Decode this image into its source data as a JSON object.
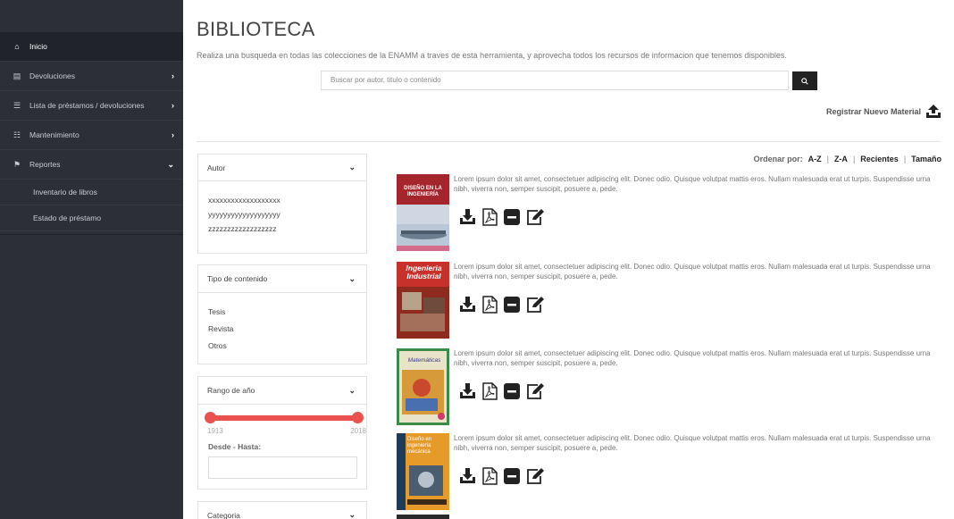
{
  "sidebar": {
    "items": [
      {
        "label": "Inicio",
        "icon": "home-icon",
        "glyph": "⌂",
        "chevron": "",
        "active": true
      },
      {
        "label": "Devoluciones",
        "icon": "file-icon",
        "glyph": "▤",
        "chevron": "›"
      },
      {
        "label": "Lista de préstamos / devoluciones",
        "icon": "list-icon",
        "glyph": "☰",
        "chevron": "›"
      },
      {
        "label": "Mantenimiento",
        "icon": "grid-icon",
        "glyph": "☷",
        "chevron": "›"
      },
      {
        "label": "Reportes",
        "icon": "report-icon",
        "glyph": "⚑",
        "chevron": "⌄"
      }
    ],
    "subitems": [
      "Inventario de libros",
      "Estado de préstamo"
    ]
  },
  "main": {
    "title": "BIBLIOTECA",
    "subtitle": "Realiza una busqueda en todas las colecciones de la ENAMM a traves de esta herramienta, y aprovecha todos los recursos de informacion que tenemos disponibles.",
    "search_placeholder": "Buscar por autor, titulo o contenido",
    "register_label": "Registrar Nuevo Material"
  },
  "filters": {
    "autor": {
      "label": "Autor",
      "options": [
        "xxxxxxxxxxxxxxxxxxx",
        "yyyyyyyyyyyyyyyyyyy",
        "zzzzzzzzzzzzzzzzzz"
      ]
    },
    "tipo": {
      "label": "Tipo de contenido",
      "options": [
        "Tesis",
        "Revista",
        "Otros"
      ]
    },
    "rango": {
      "label": "Rango de año",
      "min": "1913",
      "max": "2018",
      "desde_hasta": "Desde - Hasta:"
    },
    "categoria": {
      "label": "Categoria"
    }
  },
  "sort": {
    "label": "Ordenar por:",
    "options": [
      "A-Z",
      "Z-A",
      "Recientes",
      "Tamaño"
    ]
  },
  "results": [
    {
      "cover_title": "DISEÑO EN LA INGENIERÍA",
      "description": "Lorem ipsum dolor sit amet, consectetuer adipiscing elit. Donec odio. Quisque volutpat mattis eros. Nullam malesuada erat ut turpis. Suspendisse urna nibh, viverra non, semper suscipit, posuere a, pede."
    },
    {
      "cover_title": "Ingenieria Industrial",
      "description": "Lorem ipsum dolor sit amet, consectetuer adipiscing elit. Donec odio. Quisque volutpat mattis eros. Nullam malesuada erat ut turpis. Suspendisse urna nibh, viverra non, semper suscipit, posuere a, pede."
    },
    {
      "cover_title": "Matemáticas",
      "description": "Lorem ipsum dolor sit amet, consectetuer adipiscing elit. Donec odio. Quisque volutpat mattis eros. Nullam malesuada erat ut turpis. Suspendisse urna nibh, viverra non, semper suscipit, posuere a, pede."
    },
    {
      "cover_title": "Diseño en ingeniería mecánica",
      "description": "Lorem ipsum dolor sit amet, consectetuer adipiscing elit. Donec odio. Quisque volutpat mattis eros. Nullam malesuada erat ut turpis. Suspendisse urna nibh, viverra non, semper suscipit, posuere a, pede."
    }
  ],
  "colors": {
    "sidebar": "#2c3036",
    "accent": "#e9524f",
    "search_button": "#222222"
  }
}
